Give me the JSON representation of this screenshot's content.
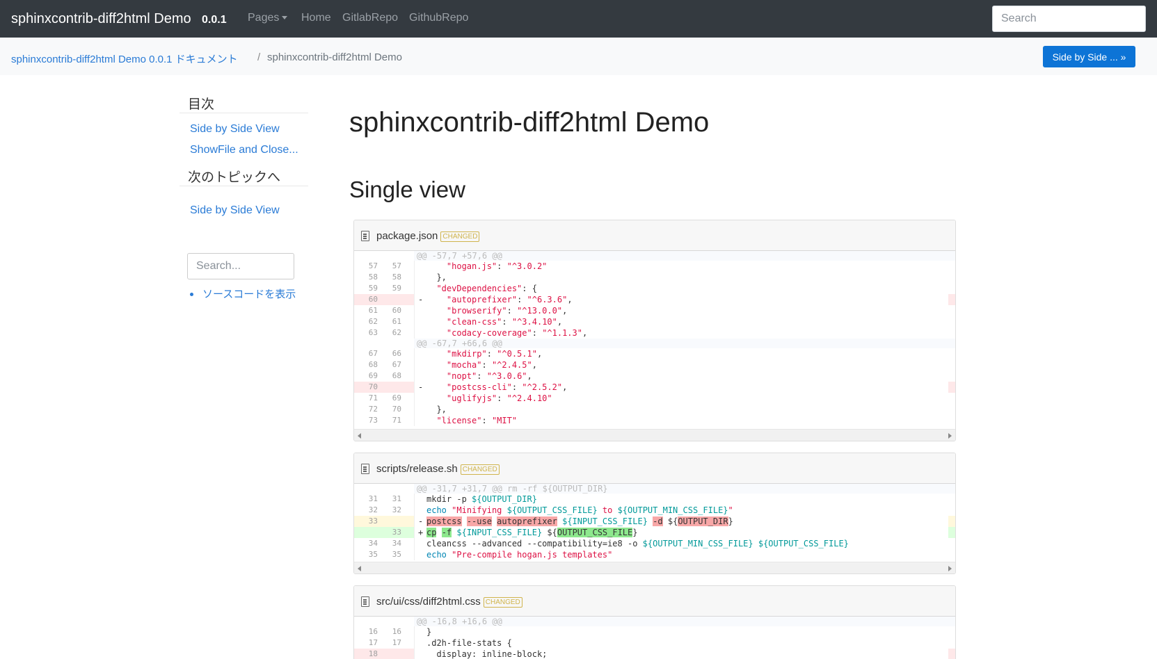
{
  "navbar": {
    "brand": "sphinxcontrib-diff2html Demo",
    "version": "0.0.1",
    "links": [
      "Pages",
      "Home",
      "GitlabRepo",
      "GithubRepo"
    ],
    "search_placeholder": "Search"
  },
  "breadcrumb": {
    "root": "sphinxcontrib-diff2html Demo 0.0.1 ドキュメント",
    "separator": "/",
    "current": "sphinxcontrib-diff2html Demo",
    "button": "Side by Side ... »"
  },
  "sidebar": {
    "toc_heading": "目次",
    "toc_items": [
      "Side by Side View",
      "ShowFile and Close..."
    ],
    "next_heading": "次のトピックへ",
    "next_items": [
      "Side by Side View"
    ],
    "search_placeholder": "Search...",
    "source_link": "ソースコードを表示"
  },
  "main": {
    "title": "sphinxcontrib-diff2html Demo",
    "section": "Single view",
    "changed_label": "CHANGED"
  },
  "files": [
    {
      "name": "package.json",
      "rows": [
        {
          "type": "info",
          "text": "@@ -57,7 +57,6 @@"
        },
        {
          "type": "ctx",
          "l": "57",
          "r": "57",
          "segs": [
            [
              "",
              "    "
            ],
            [
              "str",
              "\"hogan.js\""
            ],
            [
              "",
              ": "
            ],
            [
              "str",
              "\"^3.0.2\""
            ]
          ]
        },
        {
          "type": "ctx",
          "l": "58",
          "r": "58",
          "segs": [
            [
              "",
              "  },"
            ]
          ]
        },
        {
          "type": "ctx",
          "l": "59",
          "r": "59",
          "segs": [
            [
              "",
              "  "
            ],
            [
              "str",
              "\"devDependencies\""
            ],
            [
              "",
              ": {"
            ]
          ]
        },
        {
          "type": "del",
          "l": "60",
          "r": "",
          "sign": "-",
          "segs": [
            [
              "",
              "    "
            ],
            [
              "str",
              "\"autoprefixer\""
            ],
            [
              "",
              ": "
            ],
            [
              "str",
              "\"^6.3.6\""
            ],
            [
              "",
              ","
            ]
          ]
        },
        {
          "type": "ctx",
          "l": "61",
          "r": "60",
          "segs": [
            [
              "",
              "    "
            ],
            [
              "str",
              "\"browserify\""
            ],
            [
              "",
              ": "
            ],
            [
              "str",
              "\"^13.0.0\""
            ],
            [
              "",
              ","
            ]
          ]
        },
        {
          "type": "ctx",
          "l": "62",
          "r": "61",
          "segs": [
            [
              "",
              "    "
            ],
            [
              "str",
              "\"clean-css\""
            ],
            [
              "",
              ": "
            ],
            [
              "str",
              "\"^3.4.10\""
            ],
            [
              "",
              ","
            ]
          ]
        },
        {
          "type": "ctx",
          "l": "63",
          "r": "62",
          "segs": [
            [
              "",
              "    "
            ],
            [
              "str",
              "\"codacy-coverage\""
            ],
            [
              "",
              ": "
            ],
            [
              "str",
              "\"^1.1.3\""
            ],
            [
              "",
              ","
            ]
          ]
        },
        {
          "type": "info",
          "text": "@@ -67,7 +66,6 @@"
        },
        {
          "type": "ctx",
          "l": "67",
          "r": "66",
          "segs": [
            [
              "",
              "    "
            ],
            [
              "str",
              "\"mkdirp\""
            ],
            [
              "",
              ": "
            ],
            [
              "str",
              "\"^0.5.1\""
            ],
            [
              "",
              ","
            ]
          ]
        },
        {
          "type": "ctx",
          "l": "68",
          "r": "67",
          "segs": [
            [
              "",
              "    "
            ],
            [
              "str",
              "\"mocha\""
            ],
            [
              "",
              ": "
            ],
            [
              "str",
              "\"^2.4.5\""
            ],
            [
              "",
              ","
            ]
          ]
        },
        {
          "type": "ctx",
          "l": "69",
          "r": "68",
          "segs": [
            [
              "",
              "    "
            ],
            [
              "str",
              "\"nopt\""
            ],
            [
              "",
              ": "
            ],
            [
              "str",
              "\"^3.0.6\""
            ],
            [
              "",
              ","
            ]
          ]
        },
        {
          "type": "del",
          "l": "70",
          "r": "",
          "sign": "-",
          "segs": [
            [
              "",
              "    "
            ],
            [
              "str",
              "\"postcss-cli\""
            ],
            [
              "",
              ": "
            ],
            [
              "str",
              "\"^2.5.2\""
            ],
            [
              "",
              ","
            ]
          ]
        },
        {
          "type": "ctx",
          "l": "71",
          "r": "69",
          "segs": [
            [
              "",
              "    "
            ],
            [
              "str",
              "\"uglifyjs\""
            ],
            [
              "",
              ": "
            ],
            [
              "str",
              "\"^2.4.10\""
            ]
          ]
        },
        {
          "type": "ctx",
          "l": "72",
          "r": "70",
          "segs": [
            [
              "",
              "  },"
            ]
          ]
        },
        {
          "type": "ctx",
          "l": "73",
          "r": "71",
          "segs": [
            [
              "",
              "  "
            ],
            [
              "str",
              "\"license\""
            ],
            [
              "",
              ": "
            ],
            [
              "str",
              "\"MIT\""
            ]
          ]
        }
      ]
    },
    {
      "name": "scripts/release.sh",
      "rows": [
        {
          "type": "info",
          "text": "@@ -31,7 +31,7 @@ rm -rf ${OUTPUT_DIR}"
        },
        {
          "type": "ctx",
          "l": "31",
          "r": "31",
          "segs": [
            [
              "",
              "mkdir -p "
            ],
            [
              "var",
              "${OUTPUT_DIR}"
            ]
          ]
        },
        {
          "type": "ctx",
          "l": "32",
          "r": "32",
          "segs": [
            [
              "kw",
              "echo"
            ],
            [
              "",
              " "
            ],
            [
              "str",
              "\"Minifying "
            ],
            [
              "var",
              "${OUTPUT_CSS_FILE}"
            ],
            [
              "str",
              " to "
            ],
            [
              "var",
              "${OUTPUT_MIN_CSS_FILE}"
            ],
            [
              "str",
              "\""
            ]
          ]
        },
        {
          "type": "chg",
          "l": "33",
          "r": "",
          "sign": "-",
          "segs": [
            [
              "hl-del",
              "postcss"
            ],
            [
              "",
              " "
            ],
            [
              "hl-del",
              "--use"
            ],
            [
              "",
              " "
            ],
            [
              "hl-del",
              "autoprefixer"
            ],
            [
              "",
              " "
            ],
            [
              "var",
              "${INPUT_CSS_FILE}"
            ],
            [
              "",
              " "
            ],
            [
              "hl-del",
              "-d"
            ],
            [
              "",
              " ${"
            ],
            [
              "hl-del",
              "OUTPUT_DIR"
            ],
            [
              "",
              "}"
            ]
          ]
        },
        {
          "type": "ins",
          "l": "",
          "r": "33",
          "sign": "+",
          "segs": [
            [
              "hl-ins",
              "cp"
            ],
            [
              "",
              " "
            ],
            [
              "hl-ins",
              "-f"
            ],
            [
              "",
              " "
            ],
            [
              "var",
              "${INPUT_CSS_FILE}"
            ],
            [
              "",
              " ${"
            ],
            [
              "hl-ins",
              "OUTPUT_CSS_FILE"
            ],
            [
              "",
              "}"
            ]
          ]
        },
        {
          "type": "ctx",
          "l": "34",
          "r": "34",
          "segs": [
            [
              "",
              "cleancss --advanced --compatibility=ie8 -o "
            ],
            [
              "var",
              "${OUTPUT_MIN_CSS_FILE}"
            ],
            [
              "",
              " "
            ],
            [
              "var",
              "${OUTPUT_CSS_FILE}"
            ]
          ]
        },
        {
          "type": "ctx",
          "l": "35",
          "r": "35",
          "segs": [
            [
              "kw",
              "echo"
            ],
            [
              "",
              " "
            ],
            [
              "str",
              "\"Pre-compile hogan.js templates\""
            ]
          ]
        }
      ]
    },
    {
      "name": "src/ui/css/diff2html.css",
      "rows": [
        {
          "type": "info",
          "text": "@@ -16,8 +16,6 @@"
        },
        {
          "type": "ctx",
          "l": "16",
          "r": "16",
          "segs": [
            [
              "",
              "}"
            ]
          ]
        },
        {
          "type": "ctx",
          "l": "17",
          "r": "17",
          "segs": [
            [
              "",
              ".d2h-file-stats {"
            ]
          ]
        },
        {
          "type": "del",
          "l": "18",
          "r": "",
          "sign": "",
          "segs": [
            [
              "",
              "  display: inline-block;"
            ]
          ]
        }
      ]
    }
  ]
}
